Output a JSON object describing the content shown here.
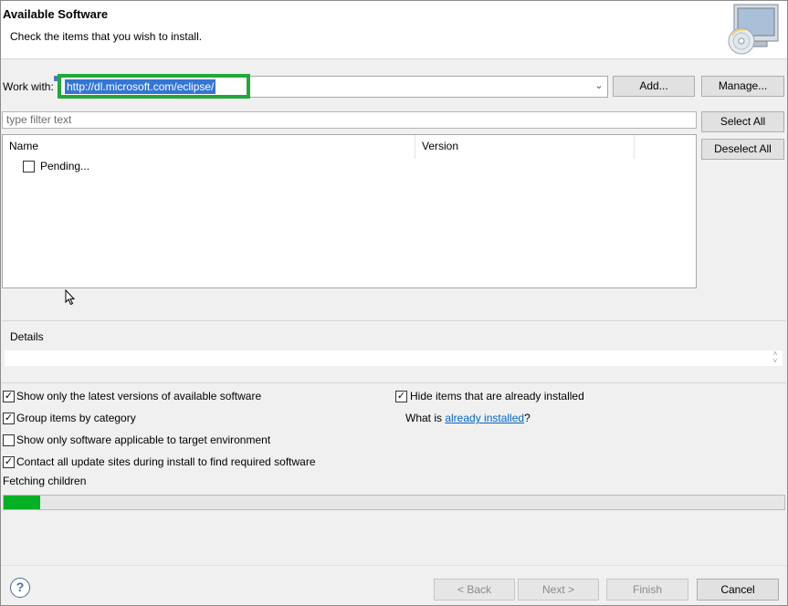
{
  "header": {
    "title": "Available Software",
    "description": "Check the items that you wish to install."
  },
  "work_with": {
    "label": "Work with:",
    "value": "http://dl.microsoft.com/eclipse/",
    "add_label": "Add...",
    "manage_label": "Manage..."
  },
  "filter": {
    "placeholder": "type filter text"
  },
  "selection": {
    "select_all_label": "Select All",
    "deselect_all_label": "Deselect All"
  },
  "table": {
    "columns": [
      "Name",
      "Version"
    ],
    "rows": [
      {
        "name": "Pending...",
        "version": "",
        "checked": false
      }
    ]
  },
  "details": {
    "label": "Details"
  },
  "options": {
    "show_latest": {
      "label": "Show only the latest versions of available software",
      "checked": true
    },
    "group_by_category": {
      "label": "Group items by category",
      "checked": true
    },
    "show_applicable": {
      "label": "Show only software applicable to target environment",
      "checked": false
    },
    "contact_update_sites": {
      "label": "Contact all update sites during install to find required software",
      "checked": true
    },
    "hide_installed": {
      "label": "Hide items that are already installed",
      "checked": true
    },
    "what_is_prefix": "What is ",
    "what_is_link": "already installed",
    "what_is_suffix": "?"
  },
  "status": {
    "text": "Fetching children",
    "progress": 0.047
  },
  "footer": {
    "help_icon": "?",
    "back_label": "< Back",
    "next_label": "Next >",
    "finish_label": "Finish",
    "cancel_label": "Cancel"
  },
  "colors": {
    "highlight_border": "#22a83a",
    "selection": "#3575d3",
    "progress": "#06b025",
    "link": "#0066cc"
  }
}
